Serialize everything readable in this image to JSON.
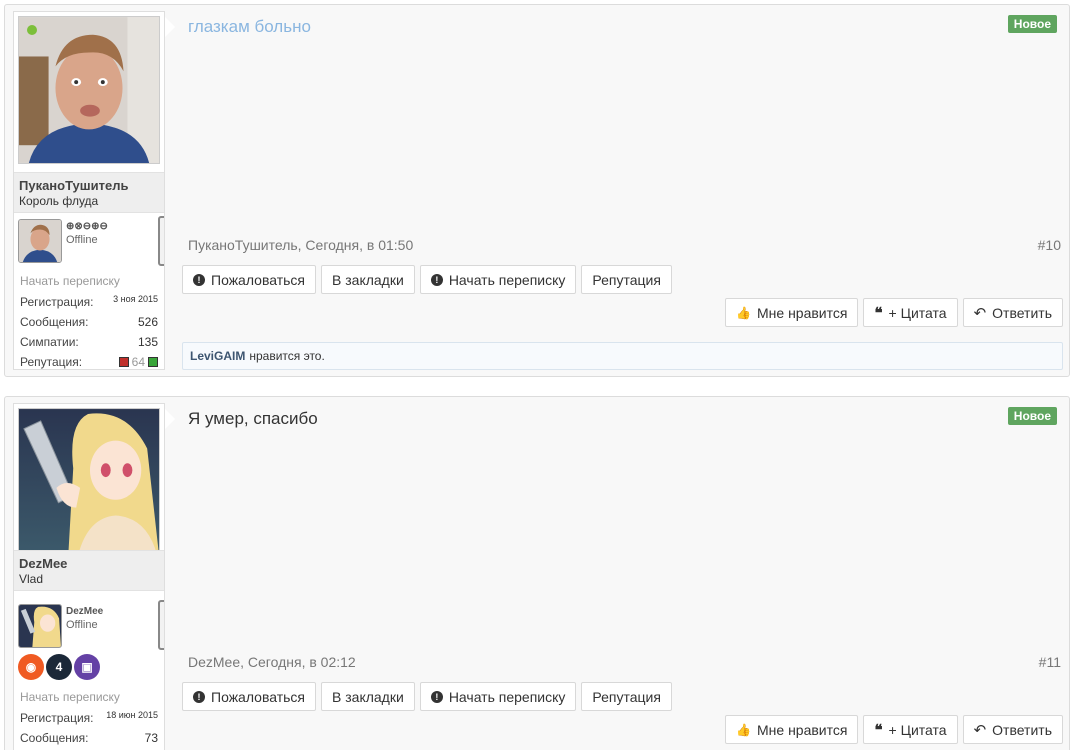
{
  "posts": [
    {
      "author": "ПуканоТушитель",
      "user_title": "Король флуда",
      "mini_name": "⊕⊗⊖⊕⊖",
      "mini_status": "Offline",
      "stats": {
        "start_convo": "Начать переписку",
        "reg_label": "Регистрация:",
        "reg_value": "3 ноя 2015",
        "msgs_label": "Сообщения:",
        "msgs_value": "526",
        "likes_label": "Симпатии:",
        "likes_value": "135",
        "rep_label": "Репутация:",
        "rep_value": "64"
      },
      "message": "глазкам больно",
      "message_color": "#8ab6e0",
      "new_label": "Новое",
      "meta": "ПуканоТушитель, Сегодня, в 01:50",
      "number": "#10",
      "liked_by": "LeviGAIM",
      "liked_text": "нравится это."
    },
    {
      "author": "DezMee",
      "user_title": "Vlad",
      "mini_name": "DezMee",
      "mini_status": "Offline",
      "badges": [
        "origin-icon",
        "steam-icon",
        "twitch-icon"
      ],
      "stats": {
        "start_convo": "Начать переписку",
        "reg_label": "Регистрация:",
        "reg_value": "18 июн 2015",
        "msgs_label": "Сообщения:",
        "msgs_value": "73"
      },
      "message": "Я умер, спасибо",
      "message_color": "#333333",
      "new_label": "Новое",
      "meta": "DezMee, Сегодня, в 02:12",
      "number": "#11"
    }
  ],
  "buttons": {
    "report": "Пожаловаться",
    "bookmark": "В закладки",
    "start_convo": "Начать переписку",
    "reputation": "Репутация",
    "like": "Мне нравится",
    "quote": "+ Цитата",
    "reply": "Ответить"
  },
  "colors": {
    "new_badge": "#5fa55f",
    "online": "#7cbf3a",
    "liked_name": "#3d5570"
  }
}
